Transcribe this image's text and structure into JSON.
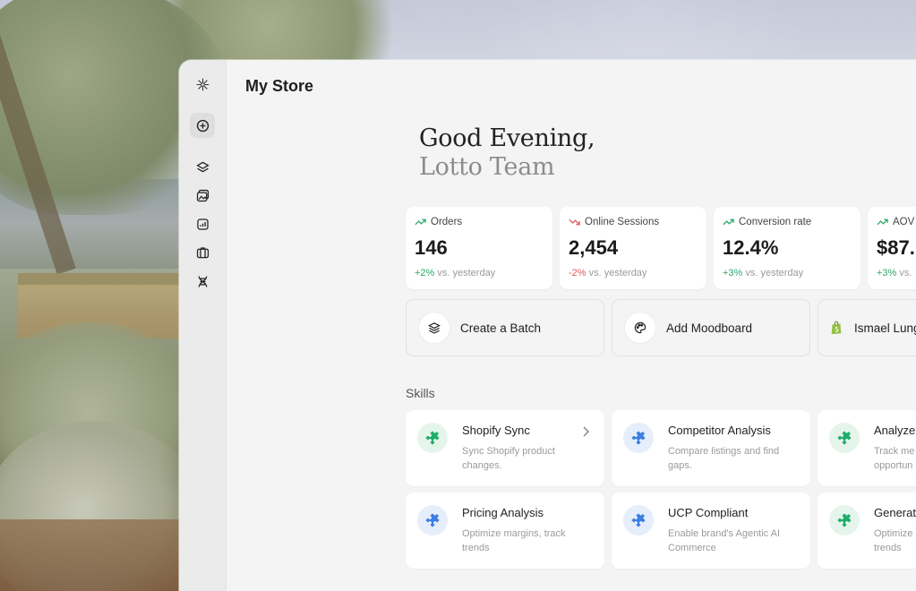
{
  "sidebar": {
    "items": [
      {
        "icon": "logo-icon"
      },
      {
        "icon": "plus-circle-icon"
      },
      {
        "icon": "layers-icon"
      },
      {
        "icon": "gallery-icon"
      },
      {
        "icon": "analytics-icon"
      },
      {
        "icon": "briefcase-icon"
      },
      {
        "icon": "dna-icon"
      }
    ]
  },
  "header": {
    "title": "My Store"
  },
  "greeting": {
    "line1": "Good Evening,",
    "line2": "Lotto Team"
  },
  "stats": [
    {
      "label": "Orders",
      "value": "146",
      "delta": "+2%",
      "direction": "up",
      "suffix": "vs. yesterday"
    },
    {
      "label": "Online Sessions",
      "value": "2,454",
      "delta": "-2%",
      "direction": "down",
      "suffix": "vs. yesterday"
    },
    {
      "label": "Conversion rate",
      "value": "12.4%",
      "delta": "+3%",
      "direction": "up",
      "suffix": "vs. yesterday"
    },
    {
      "label": "AOV",
      "value": "$87.",
      "delta": "+3%",
      "direction": "up",
      "suffix": "vs."
    }
  ],
  "actions": [
    {
      "label": "Create a Batch",
      "icon": "layers-icon"
    },
    {
      "label": "Add Moodboard",
      "icon": "palette-icon"
    },
    {
      "label": "Ismael Lungi",
      "icon": "shopify-icon"
    }
  ],
  "skills": {
    "title": "Skills",
    "items": [
      {
        "name": "Shopify Sync",
        "desc": "Sync Shopify product changes.",
        "color": "green"
      },
      {
        "name": "Competitor Analysis",
        "desc": "Compare listings and find gaps.",
        "color": "blue"
      },
      {
        "name": "Analyze",
        "desc": "Track me opportun",
        "color": "green"
      },
      {
        "name": "Pricing Analysis",
        "desc": "Optimize margins, track trends",
        "color": "blue"
      },
      {
        "name": "UCP Compliant",
        "desc": "Enable brand's Agentic AI Commerce",
        "color": "blue"
      },
      {
        "name": "Generat",
        "desc": "Optimize trends",
        "color": "green"
      }
    ]
  },
  "colors": {
    "positive": "#2fa86a",
    "negative": "#e0565b",
    "green_icon": "#1fae6a",
    "blue_icon": "#3b7fe0"
  }
}
